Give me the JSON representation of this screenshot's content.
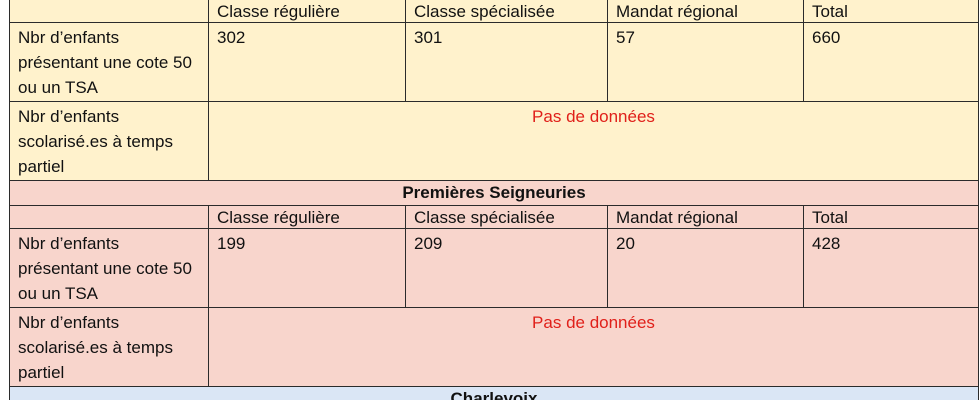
{
  "columns": [
    "Classe régulière",
    "Classe spécialisée",
    "Mandat régional",
    "Total"
  ],
  "row_labels": {
    "cote": "Nbr d’enfants présentant une cote 50 ou un TSA",
    "partiel": "Nbr d’enfants scolarisé.es à temps partiel"
  },
  "no_data": "Pas de données",
  "sections": [
    {
      "title": "",
      "values": [
        "302",
        "301",
        "57",
        "660"
      ],
      "color": "#fff2cc"
    },
    {
      "title": "Premières Seigneuries",
      "values": [
        "199",
        "209",
        "20",
        "428"
      ],
      "color": "#f8d5cc"
    },
    {
      "title": "Charlevoix",
      "color": "#dae6f5"
    }
  ]
}
